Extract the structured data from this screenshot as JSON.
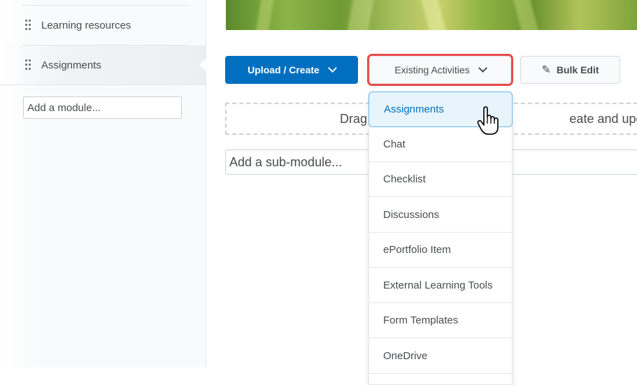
{
  "sidebar": {
    "modules": [
      {
        "label": "Learning resources",
        "active": false
      },
      {
        "label": "Assignments",
        "active": true
      }
    ],
    "add_module_placeholder": "Add a module..."
  },
  "toolbar": {
    "upload_create_label": "Upload / Create",
    "existing_activities_label": "Existing Activities",
    "bulk_edit_label": "Bulk Edit"
  },
  "content": {
    "drop_zone_left": "Drag",
    "drop_zone_right": "eate and update topic",
    "add_submodule_placeholder": "Add a sub-module..."
  },
  "existing_activities_menu": {
    "items": [
      {
        "label": "Assignments",
        "hovered": true
      },
      {
        "label": "Chat"
      },
      {
        "label": "Checklist"
      },
      {
        "label": "Discussions"
      },
      {
        "label": "ePortfolio Item"
      },
      {
        "label": "External Learning Tools"
      },
      {
        "label": "Form Templates"
      },
      {
        "label": "OneDrive"
      }
    ]
  },
  "colors": {
    "primary": "#006fbf",
    "highlight_outline": "#e84b4b",
    "menu_hover_bg": "#e8f4fc"
  }
}
